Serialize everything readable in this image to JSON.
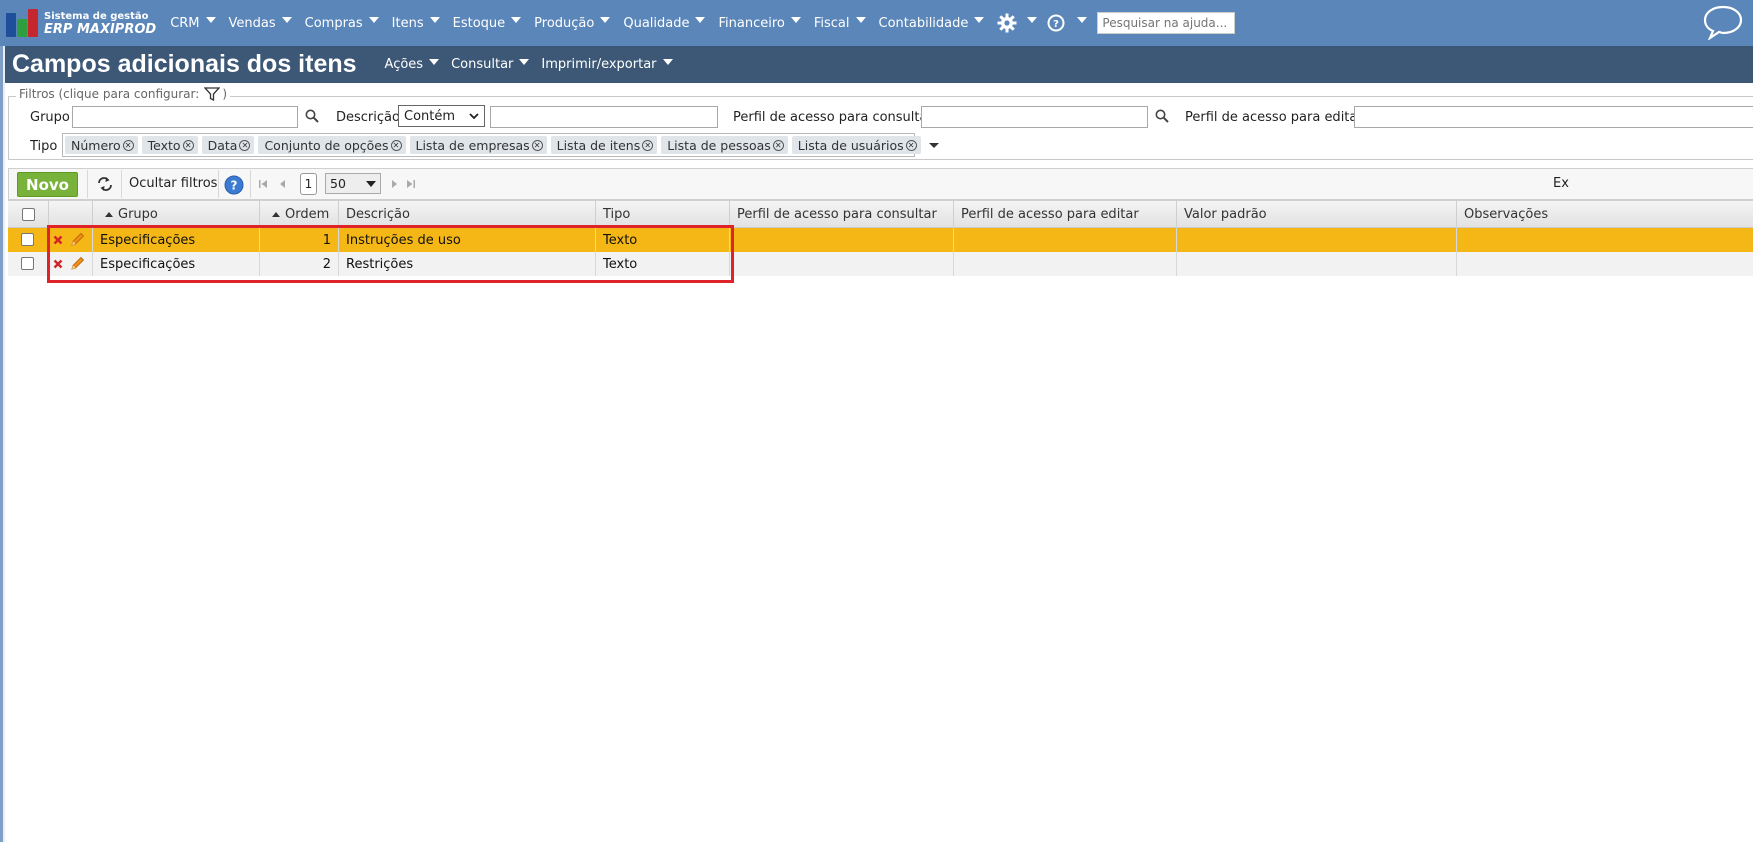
{
  "app": {
    "logo_line1": "Sistema de gestão",
    "logo_line2": "ERP MAXIPROD",
    "menu": [
      "CRM",
      "Vendas",
      "Compras",
      "Itens",
      "Estoque",
      "Produção",
      "Qualidade",
      "Financeiro",
      "Fiscal",
      "Contabilidade"
    ],
    "search_placeholder": "Pesquisar na ajuda...",
    "icons": [
      "gear-icon",
      "help-icon",
      "chat-icon"
    ],
    "colors": {
      "navbar": "#5b86b9",
      "titlebar": "#3c5876",
      "selected_row": "#f5b715",
      "novo_button": "#78b23a",
      "highlight_border": "#e0232b"
    }
  },
  "page": {
    "title": "Campos adicionais dos itens",
    "menus": [
      "Ações",
      "Consultar",
      "Imprimir/exportar"
    ]
  },
  "filters": {
    "legend": "Filtros (clique para configurar:",
    "legend_close": ")",
    "grupo_label": "Grupo",
    "descricao_label": "Descrição",
    "descricao_mode": "Contém",
    "perfil_consultar_label": "Perfil de acesso para consultar",
    "perfil_editar_label": "Perfil de acesso para editar",
    "tipo_label": "Tipo",
    "tipo_chips": [
      "Número",
      "Texto",
      "Data",
      "Conjunto de opções",
      "Lista de empresas",
      "Lista de itens",
      "Lista de pessoas",
      "Lista de usuários"
    ]
  },
  "toolbar": {
    "novo_label": "Novo",
    "hide_filters_label": "Ocultar filtros",
    "page_number": "1",
    "page_size": "50",
    "right_text": "Ex"
  },
  "grid": {
    "columns": [
      "Grupo",
      "Ordem",
      "Descrição",
      "Tipo",
      "Perfil de acesso para consultar",
      "Perfil de acesso para editar",
      "Valor padrão",
      "Observações"
    ],
    "rows": [
      {
        "grupo": "Especificações",
        "ordem": "1",
        "descricao": "Instruções de uso",
        "tipo": "Texto",
        "selected": true
      },
      {
        "grupo": "Especificações",
        "ordem": "2",
        "descricao": "Restrições",
        "tipo": "Texto",
        "selected": false
      }
    ]
  }
}
